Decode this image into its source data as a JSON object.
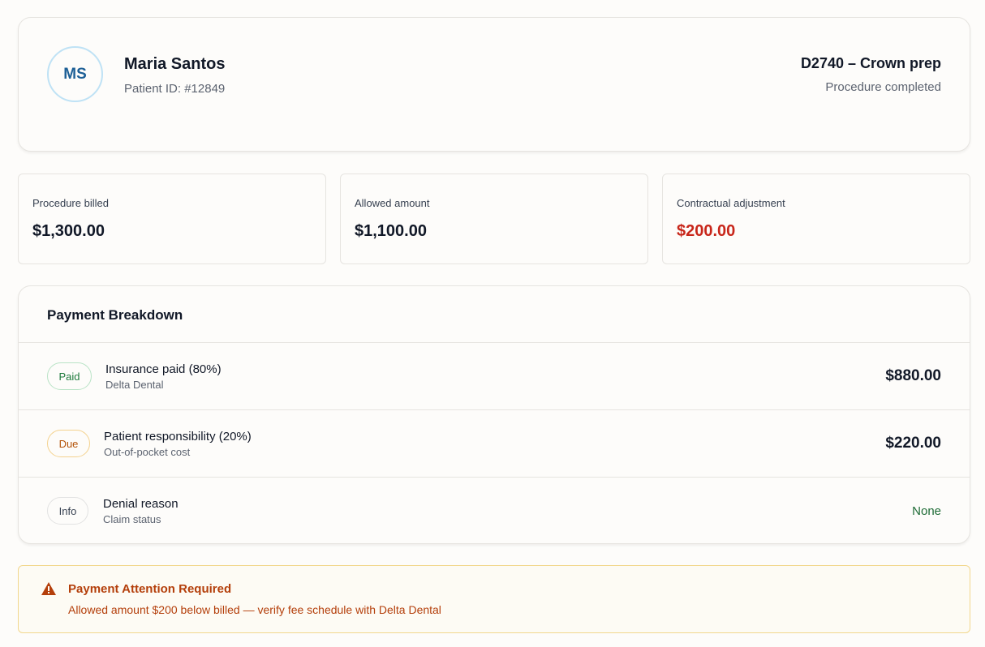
{
  "patient": {
    "initials": "MS",
    "name": "Maria Santos",
    "id_label": "Patient ID: #12849"
  },
  "procedure": {
    "code_title": "D2740 – Crown prep",
    "status": "Procedure completed"
  },
  "stats": [
    {
      "label": "Procedure billed",
      "value": "$1,300.00"
    },
    {
      "label": "Allowed amount",
      "value": "$1,100.00"
    },
    {
      "label": "Contractual adjustment",
      "value": "$200.00",
      "color": "#c8261a"
    }
  ],
  "breakdown": {
    "title": "Payment Breakdown",
    "rows": [
      {
        "badge": "Paid",
        "title": "Insurance paid (80%)",
        "subtitle": "Delta Dental",
        "amount": "$880.00"
      },
      {
        "badge": "Due",
        "title": "Patient responsibility (20%)",
        "subtitle": "Out-of-pocket cost",
        "amount": "$220.00"
      },
      {
        "badge": "Info",
        "title": "Denial reason",
        "subtitle": "Claim status",
        "amount": "None"
      }
    ]
  },
  "alert": {
    "icon": "warning-icon",
    "title": "Payment Attention Required",
    "message": "Allowed amount $200 below billed — verify fee schedule with Delta Dental"
  },
  "colors": {
    "accent_blue": "#1d5f96",
    "danger": "#c8261a",
    "success": "#1d7a3c",
    "warning": "#b45309"
  }
}
